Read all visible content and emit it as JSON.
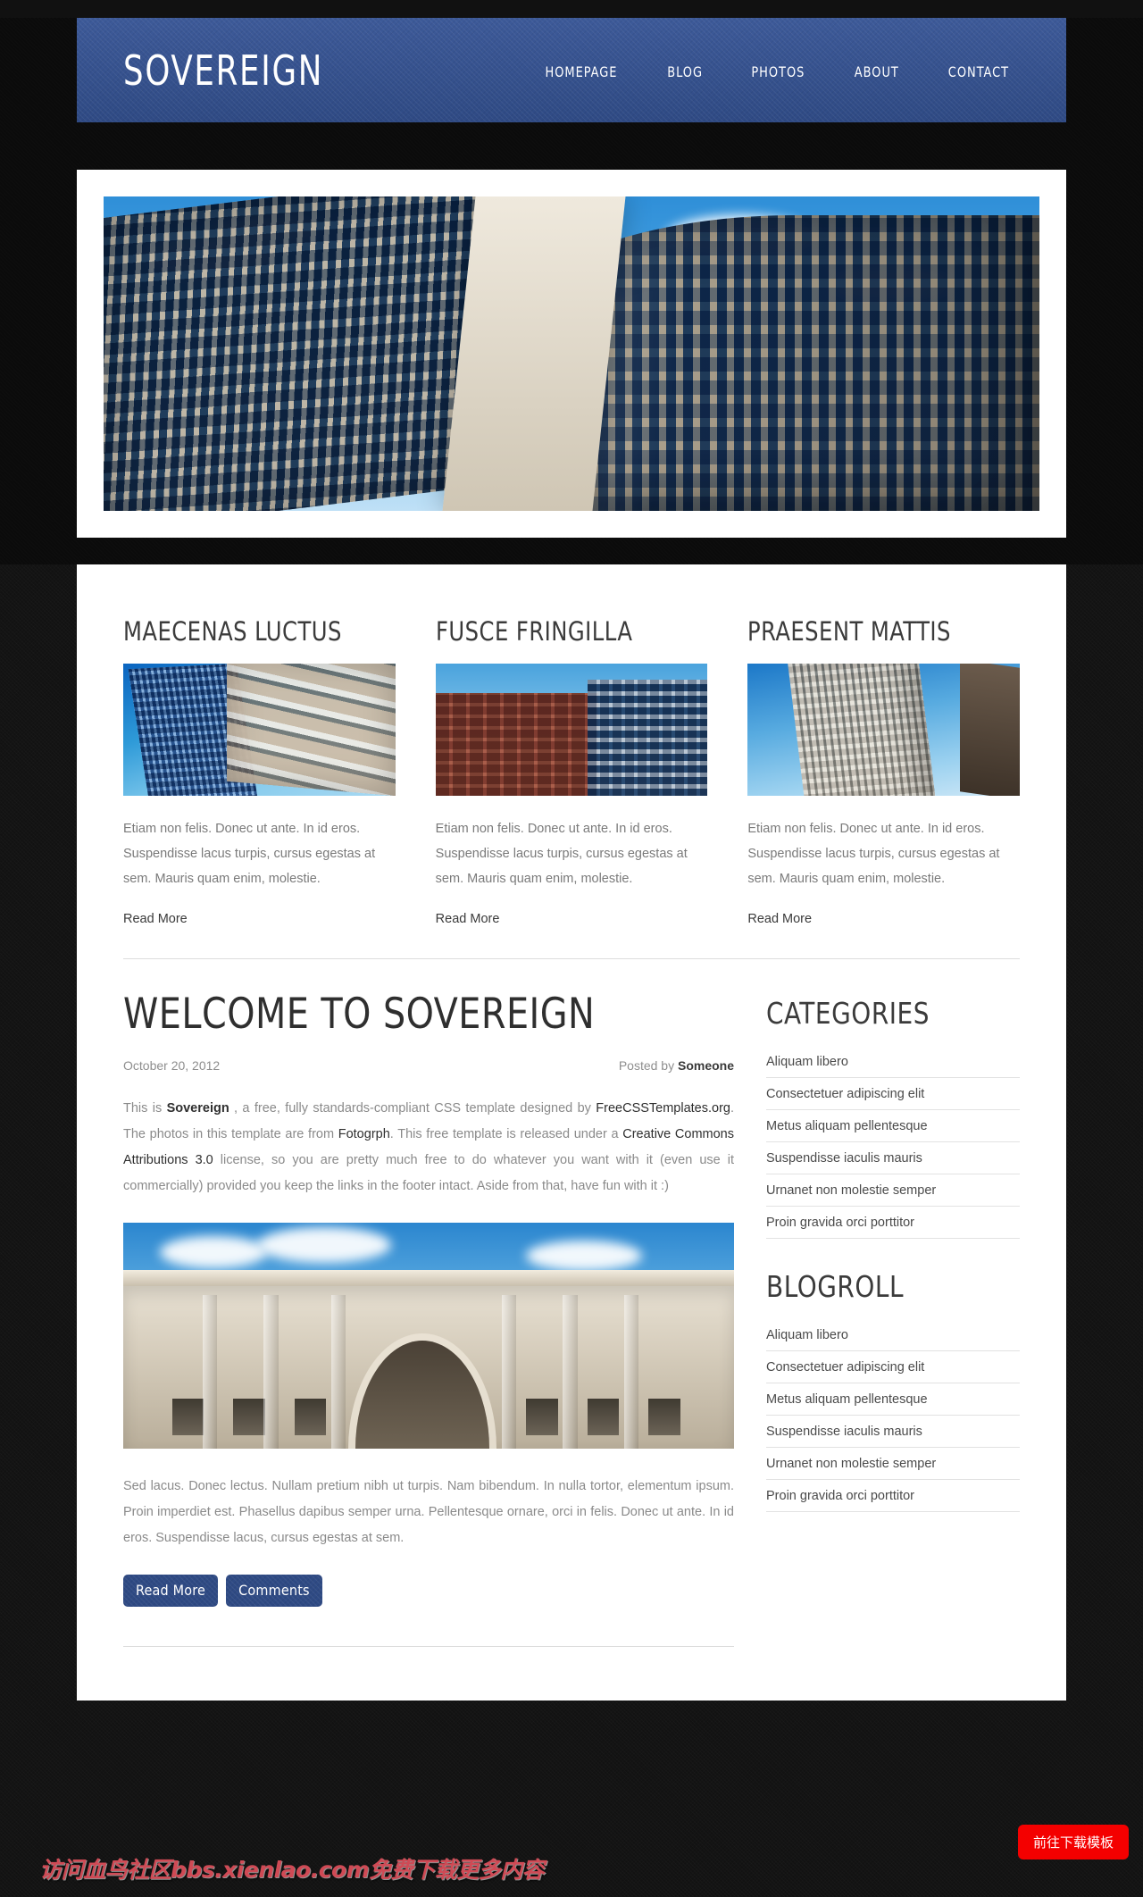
{
  "site": {
    "logo": "SOVEREIGN",
    "nav": [
      {
        "label": "HOMEPAGE"
      },
      {
        "label": "BLOG"
      },
      {
        "label": "PHOTOS"
      },
      {
        "label": "ABOUT"
      },
      {
        "label": "CONTACT"
      }
    ]
  },
  "banner": {
    "alt": "modern-office-building-photo"
  },
  "features": [
    {
      "title": "MAECENAS LUCTUS",
      "image": "high-rise-apartment-photo",
      "body": "Etiam non felis. Donec ut ante. In id eros. Suspendisse lacus turpis, cursus egestas at sem. Mauris quam enim, molestie.",
      "link": "Read More"
    },
    {
      "title": "FUSCE FRINGILLA",
      "image": "brick-apartment-block-photo",
      "body": "Etiam non felis. Donec ut ante. In id eros. Suspendisse lacus turpis, cursus egestas at sem. Mauris quam enim, molestie.",
      "link": "Read More"
    },
    {
      "title": "PRAESENT MATTIS",
      "image": "tall-tower-photo",
      "body": "Etiam non felis. Donec ut ante. In id eros. Suspendisse lacus turpis, cursus egestas at sem. Mauris quam enim, molestie.",
      "link": "Read More"
    }
  ],
  "post": {
    "title": "WELCOME TO SOVEREIGN",
    "date": "October 20, 2012",
    "posted_by_prefix": "Posted by ",
    "author": "Someone",
    "paragraph1": {
      "p1": "This is ",
      "strong1": "Sovereign",
      "p2": " , a free, fully standards-compliant CSS template designed by ",
      "link1": "FreeCSSTemplates.org",
      "p3": ". The photos in this template are from ",
      "link2": "Fotogrph",
      "p4": ". This free template is released under a ",
      "link3": "Creative Commons Attributions 3.0",
      "p5": " license, so you are pretty much free to do whatever you want with it (even use it commercially) provided you keep the links in the footer intact. Aside from that, have fun with it :)"
    },
    "image": "classical-stone-building-photo",
    "paragraph2": "Sed lacus. Donec lectus. Nullam pretium nibh ut turpis. Nam bibendum. In nulla tortor, elementum ipsum. Proin imperdiet est. Phasellus dapibus semper urna. Pellentesque ornare, orci in felis. Donec ut ante. In id eros. Suspendisse lacus, cursus egestas at sem.",
    "buttons": {
      "read_more": "Read More",
      "comments": "Comments"
    }
  },
  "sidebar": {
    "categories_title": "CATEGORIES",
    "categories": [
      "Aliquam libero",
      "Consectetuer adipiscing elit",
      "Metus aliquam pellentesque",
      "Suspendisse iaculis mauris",
      "Urnanet non molestie semper",
      "Proin gravida orci porttitor"
    ],
    "blogroll_title": "BLOGROLL",
    "blogroll": [
      "Aliquam libero",
      "Consectetuer adipiscing elit",
      "Metus aliquam pellentesque",
      "Suspendisse iaculis mauris",
      "Urnanet non molestie semper",
      "Proin gravida orci porttitor"
    ]
  },
  "overlay": {
    "watermark": "访问血鸟社区bbs.xienlao.com免费下载更多内容",
    "download_button": "前往下载模板"
  },
  "colors": {
    "header_blue": "#36528f",
    "button_blue": "#2f4a84",
    "page_dark": "#121212",
    "download_red": "#f40000",
    "watermark_red": "#cf4a55"
  }
}
